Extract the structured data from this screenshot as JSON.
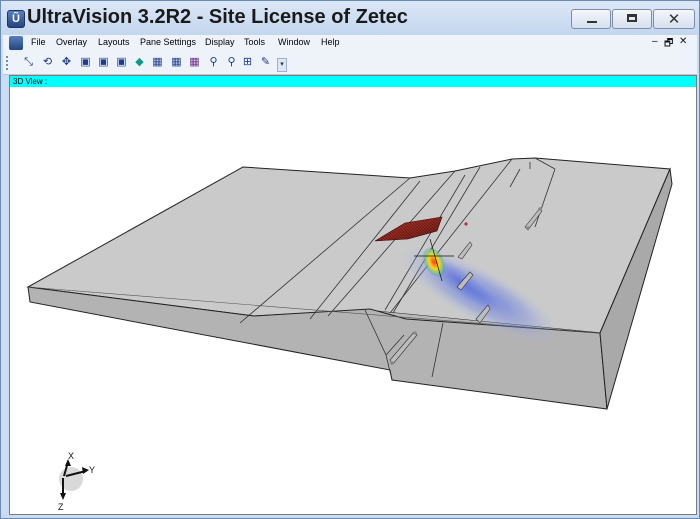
{
  "window": {
    "title": "UltraVision 3.2R2 - Site License of Zetec",
    "controls": {
      "minimize": "",
      "maximize": "",
      "close": "✕"
    }
  },
  "menu": {
    "items": [
      "File",
      "Overlay",
      "Layouts",
      "Pane Settings",
      "Display",
      "Tools",
      "Window",
      "Help"
    ],
    "mdi_controls": {
      "minimize": "–",
      "restore": "🗗",
      "close": "✕"
    }
  },
  "toolbar": {
    "icons": [
      "pointer-zoom-icon",
      "rotate-icon",
      "pan-icon",
      "view-front-icon",
      "view-side-icon",
      "view-top-icon",
      "view-iso-icon",
      "grid-1-icon",
      "grid-2-icon",
      "grid-3-icon",
      "zoom-in-icon",
      "zoom-out-icon",
      "zoom-fit-icon",
      "annotate-icon"
    ],
    "overflow": "▾"
  },
  "pane": {
    "title": "3D View :"
  },
  "axes": {
    "x": "X",
    "y": "Y",
    "z": "Z"
  }
}
